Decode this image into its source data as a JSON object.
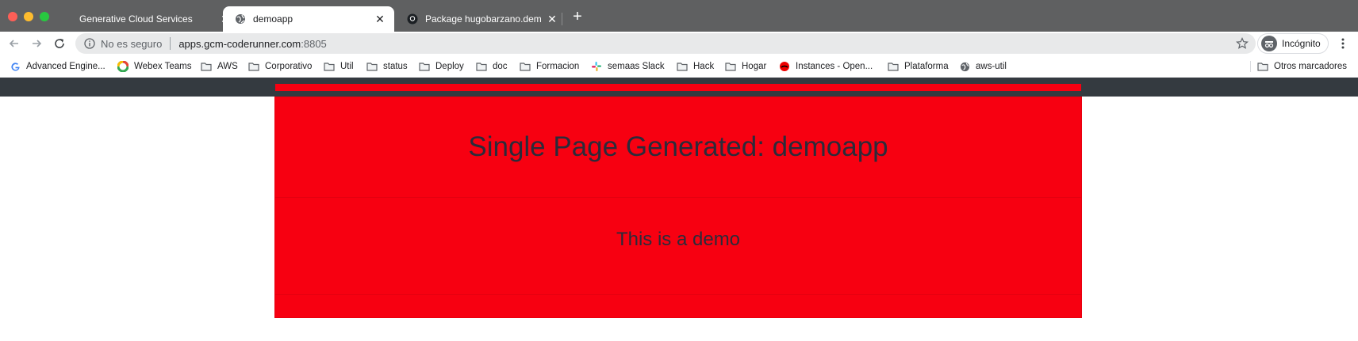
{
  "browser": {
    "tabs": [
      {
        "title": "Generative Cloud Services",
        "icon": "blank-icon",
        "active": false
      },
      {
        "title": "demoapp",
        "icon": "globe-icon",
        "active": true
      },
      {
        "title": "Package hugobarzano.demoapp",
        "icon": "github-icon",
        "active": false
      }
    ],
    "new_tab": "+",
    "close_glyph": "✕",
    "address": {
      "security_label": "No es seguro",
      "host": "apps.gcm-coderunner.com",
      "port": ":8805"
    },
    "profile_label": "Incógnito",
    "bookmarks": [
      {
        "label": "Advanced Engine...",
        "icon": "google-icon"
      },
      {
        "label": "Webex Teams",
        "icon": "webex-icon"
      },
      {
        "label": "AWS",
        "icon": "folder-icon"
      },
      {
        "label": "Corporativo",
        "icon": "folder-icon"
      },
      {
        "label": "Util",
        "icon": "folder-icon"
      },
      {
        "label": "status",
        "icon": "folder-icon"
      },
      {
        "label": "Deploy",
        "icon": "folder-icon"
      },
      {
        "label": "doc",
        "icon": "folder-icon"
      },
      {
        "label": "Formacion",
        "icon": "folder-icon"
      },
      {
        "label": "semaas Slack",
        "icon": "slack-icon"
      },
      {
        "label": "Hack",
        "icon": "folder-icon"
      },
      {
        "label": "Hogar",
        "icon": "folder-icon"
      },
      {
        "label": "Instances - Open...",
        "icon": "redhat-icon"
      },
      {
        "label": "Plataforma",
        "icon": "folder-icon"
      },
      {
        "label": "aws-util",
        "icon": "globe-icon"
      }
    ],
    "other_bookmarks": "Otros marcadores"
  },
  "page": {
    "heading": "Single Page Generated: demoapp",
    "text": "This is a demo",
    "colors": {
      "accent": "#f70011",
      "navbar": "#343a40"
    }
  }
}
